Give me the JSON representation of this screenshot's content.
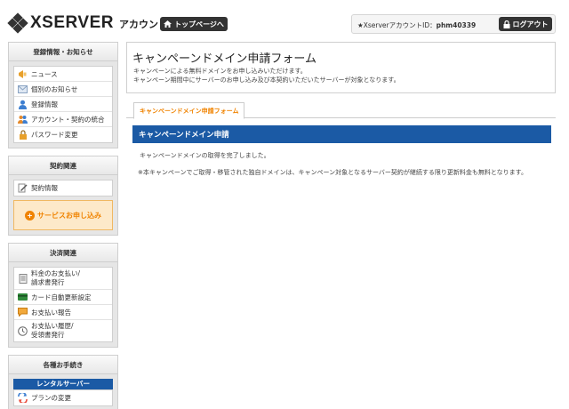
{
  "header": {
    "logo_text": "XSERVER",
    "logo_sub": "アカウント",
    "top_page_label": "トップページへ",
    "account_id_label": "★XserverアカウントID：",
    "account_id_value": "phm40339",
    "logout_label": "ログアウト"
  },
  "sidebar": {
    "info": {
      "title": "登録情報・お知らせ",
      "items": [
        {
          "label": "ニュース",
          "icon": "megaphone-icon"
        },
        {
          "label": "個別のお知らせ",
          "icon": "mail-icon"
        },
        {
          "label": "登録情報",
          "icon": "user-icon"
        },
        {
          "label": "アカウント・契約の統合",
          "icon": "merge-users-icon"
        },
        {
          "label": "パスワード変更",
          "icon": "lock-icon"
        }
      ]
    },
    "contract": {
      "title": "契約関連",
      "items": [
        {
          "label": "契約情報",
          "icon": "document-pen-icon"
        }
      ],
      "service_button": "サービスお申し込み"
    },
    "payment": {
      "title": "決済関連",
      "items": [
        {
          "label_line1": "料金のお支払い/",
          "label_line2": "請求書発行",
          "icon": "invoice-icon"
        },
        {
          "label": "カード自動更新設定",
          "icon": "credit-card-icon"
        },
        {
          "label": "お支払い報告",
          "icon": "report-icon"
        },
        {
          "label_line1": "お支払い履歴/",
          "label_line2": "受領書発行",
          "icon": "clock-icon"
        }
      ]
    },
    "procedures": {
      "title": "各種お手続き",
      "rental_head": "レンタルサーバー",
      "items": [
        {
          "label": "プランの変更",
          "icon": "plan-change-icon"
        }
      ]
    }
  },
  "main": {
    "title": "キャンペーンドメイン申請フォーム",
    "desc_line1": "キャンペーンによる無料ドメインをお申し込みいただけます。",
    "desc_line2": "キャンペーン期間中にサーバーのお申し込み及び本契約いただいたサーバーが対象となります。",
    "tab_label": "キャンペーンドメイン申請フォーム",
    "section_title": "キャンペーンドメイン申請",
    "message": "キャンペーンドメインの取得を完了しました。",
    "note": "※本キャンペーンでご取得・移管された独自ドメインは、キャンペーン対象となるサーバー契約が継続する限り更新料金も無料となります。"
  },
  "colors": {
    "brand_blue": "#1b5aa5",
    "accent_orange": "#f08300",
    "dark_button": "#333333"
  }
}
